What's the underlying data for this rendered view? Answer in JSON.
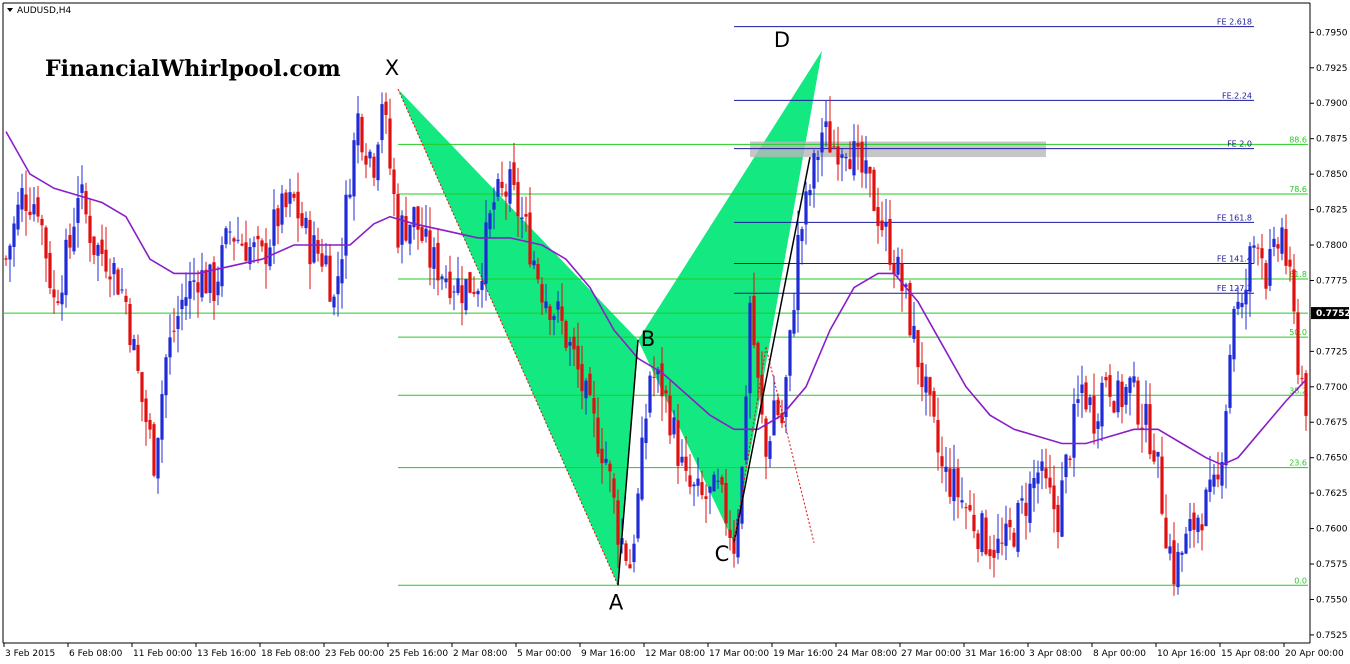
{
  "chart_data": {
    "type": "candlestick",
    "symbol": "AUDUSD,H4",
    "watermark": "FinancialWhirlpool.com",
    "colors": {
      "bull": "#1f2bd6",
      "bear": "#e01010",
      "moving_average": "#8a1ec8",
      "fib_line": "#22cc22",
      "fib_label": "#22cc22",
      "fe_line": "#1a1a9e",
      "fe_label": "#1a1a9e",
      "pattern_fill": "#00e676",
      "gray_zone": "#b8b8b8",
      "current_price_box": "#000000"
    },
    "ylim": [
      0.752,
      0.797
    ],
    "price_ticks": [
      "0.7950",
      "0.7925",
      "0.7900",
      "0.7875",
      "0.7850",
      "0.7825",
      "0.7800",
      "0.7775",
      "0.7725",
      "0.7700",
      "0.7675",
      "0.7650",
      "0.7625",
      "0.7600",
      "0.7575",
      "0.7550",
      "0.7525"
    ],
    "current_price": "0.7752",
    "x_ticks": [
      {
        "label": "3 Feb 2015",
        "bar": 0
      },
      {
        "label": "6 Feb 08:00",
        "bar": 16
      },
      {
        "label": "11 Feb 00:00",
        "bar": 32
      },
      {
        "label": "13 Feb 16:00",
        "bar": 48
      },
      {
        "label": "18 Feb 08:00",
        "bar": 64
      },
      {
        "label": "23 Feb 00:00",
        "bar": 80
      },
      {
        "label": "25 Feb 16:00",
        "bar": 96
      },
      {
        "label": "2 Mar 08:00",
        "bar": 112
      },
      {
        "label": "5 Mar 00:00",
        "bar": 128
      },
      {
        "label": "9 Mar 16:00",
        "bar": 144
      },
      {
        "label": "12 Mar 08:00",
        "bar": 160
      },
      {
        "label": "17 Mar 00:00",
        "bar": 176
      },
      {
        "label": "19 Mar 16:00",
        "bar": 192
      },
      {
        "label": "24 Mar 08:00",
        "bar": 208
      },
      {
        "label": "27 Mar 00:00",
        "bar": 224
      },
      {
        "label": "31 Mar 16:00",
        "bar": 240
      },
      {
        "label": "3 Apr 08:00",
        "bar": 256
      },
      {
        "label": "8 Apr 00:00",
        "bar": 272
      },
      {
        "label": "10 Apr 16:00",
        "bar": 288
      },
      {
        "label": "15 Apr 08:00",
        "bar": 304
      },
      {
        "label": "20 Apr 00:00",
        "bar": 320
      }
    ],
    "bar_count": 326,
    "close_path": [
      [
        0,
        0.779
      ],
      [
        4,
        0.7835
      ],
      [
        8,
        0.783
      ],
      [
        12,
        0.776
      ],
      [
        16,
        0.78
      ],
      [
        18,
        0.784
      ],
      [
        22,
        0.78
      ],
      [
        26,
        0.779
      ],
      [
        30,
        0.776
      ],
      [
        34,
        0.769
      ],
      [
        37,
        0.765
      ],
      [
        40,
        0.772
      ],
      [
        44,
        0.776
      ],
      [
        48,
        0.778
      ],
      [
        52,
        0.777
      ],
      [
        56,
        0.781
      ],
      [
        60,
        0.78
      ],
      [
        64,
        0.779
      ],
      [
        68,
        0.782
      ],
      [
        72,
        0.783
      ],
      [
        76,
        0.78
      ],
      [
        80,
        0.779
      ],
      [
        82,
        0.776
      ],
      [
        84,
        0.78
      ],
      [
        86,
        0.785
      ],
      [
        88,
        0.789
      ],
      [
        90,
        0.787
      ],
      [
        92,
        0.786
      ],
      [
        94,
        0.7905
      ],
      [
        96,
        0.7855
      ],
      [
        98,
        0.781
      ],
      [
        102,
        0.782
      ],
      [
        106,
        0.779
      ],
      [
        110,
        0.778
      ],
      [
        114,
        0.777
      ],
      [
        118,
        0.7775
      ],
      [
        122,
        0.783
      ],
      [
        126,
        0.784
      ],
      [
        130,
        0.781
      ],
      [
        134,
        0.777
      ],
      [
        138,
        0.775
      ],
      [
        142,
        0.772
      ],
      [
        146,
        0.768
      ],
      [
        150,
        0.765
      ],
      [
        153,
        0.76
      ],
      [
        156,
        0.7575
      ],
      [
        158,
        0.762
      ],
      [
        161,
        0.771
      ],
      [
        164,
        0.77
      ],
      [
        166,
        0.768
      ],
      [
        170,
        0.763
      ],
      [
        174,
        0.762
      ],
      [
        178,
        0.7625
      ],
      [
        180,
        0.761
      ],
      [
        182,
        0.759
      ],
      [
        184,
        0.764
      ],
      [
        186,
        0.776
      ],
      [
        188,
        0.77
      ],
      [
        190,
        0.765
      ],
      [
        192,
        0.769
      ],
      [
        194,
        0.7675
      ],
      [
        196,
        0.773
      ],
      [
        198,
        0.78
      ],
      [
        201,
        0.784
      ],
      [
        204,
        0.788
      ],
      [
        207,
        0.787
      ],
      [
        210,
        0.7875
      ],
      [
        213,
        0.7855
      ],
      [
        216,
        0.784
      ],
      [
        219,
        0.7815
      ],
      [
        222,
        0.779
      ],
      [
        225,
        0.776
      ],
      [
        228,
        0.772
      ],
      [
        231,
        0.768
      ],
      [
        234,
        0.764
      ],
      [
        237,
        0.763
      ],
      [
        240,
        0.7615
      ],
      [
        243,
        0.76
      ],
      [
        246,
        0.759
      ],
      [
        249,
        0.7585
      ],
      [
        252,
        0.76
      ],
      [
        255,
        0.762
      ],
      [
        258,
        0.764
      ],
      [
        261,
        0.762
      ],
      [
        263,
        0.761
      ],
      [
        266,
        0.766
      ],
      [
        269,
        0.77
      ],
      [
        272,
        0.768
      ],
      [
        275,
        0.771
      ],
      [
        278,
        0.769
      ],
      [
        281,
        0.77
      ],
      [
        284,
        0.768
      ],
      [
        287,
        0.766
      ],
      [
        290,
        0.76
      ],
      [
        292,
        0.757
      ],
      [
        295,
        0.759
      ],
      [
        298,
        0.761
      ],
      [
        301,
        0.762
      ],
      [
        303,
        0.763
      ],
      [
        305,
        0.769
      ],
      [
        307,
        0.776
      ],
      [
        309,
        0.775
      ],
      [
        311,
        0.779
      ],
      [
        313,
        0.781
      ],
      [
        315,
        0.778
      ],
      [
        317,
        0.779
      ],
      [
        319,
        0.781
      ],
      [
        321,
        0.777
      ],
      [
        323,
        0.772
      ],
      [
        325,
        0.769
      ]
    ],
    "moving_average": [
      [
        0,
        0.788
      ],
      [
        6,
        0.785
      ],
      [
        12,
        0.784
      ],
      [
        18,
        0.7835
      ],
      [
        24,
        0.783
      ],
      [
        30,
        0.782
      ],
      [
        36,
        0.779
      ],
      [
        42,
        0.778
      ],
      [
        48,
        0.778
      ],
      [
        56,
        0.7785
      ],
      [
        64,
        0.779
      ],
      [
        72,
        0.78
      ],
      [
        80,
        0.78
      ],
      [
        86,
        0.78
      ],
      [
        92,
        0.7815
      ],
      [
        96,
        0.782
      ],
      [
        102,
        0.7815
      ],
      [
        110,
        0.781
      ],
      [
        118,
        0.7805
      ],
      [
        126,
        0.7805
      ],
      [
        134,
        0.78
      ],
      [
        140,
        0.779
      ],
      [
        146,
        0.777
      ],
      [
        152,
        0.774
      ],
      [
        158,
        0.772
      ],
      [
        164,
        0.771
      ],
      [
        170,
        0.7695
      ],
      [
        176,
        0.768
      ],
      [
        182,
        0.767
      ],
      [
        188,
        0.767
      ],
      [
        194,
        0.768
      ],
      [
        200,
        0.77
      ],
      [
        206,
        0.774
      ],
      [
        212,
        0.777
      ],
      [
        218,
        0.778
      ],
      [
        222,
        0.778
      ],
      [
        228,
        0.776
      ],
      [
        234,
        0.773
      ],
      [
        240,
        0.77
      ],
      [
        246,
        0.768
      ],
      [
        252,
        0.767
      ],
      [
        258,
        0.7665
      ],
      [
        264,
        0.766
      ],
      [
        270,
        0.766
      ],
      [
        276,
        0.7665
      ],
      [
        282,
        0.767
      ],
      [
        288,
        0.767
      ],
      [
        294,
        0.766
      ],
      [
        300,
        0.765
      ],
      [
        304,
        0.7645
      ],
      [
        308,
        0.765
      ],
      [
        314,
        0.767
      ],
      [
        320,
        0.769
      ],
      [
        325,
        0.7705
      ]
    ],
    "pattern_points": [
      {
        "label": "X",
        "bar": 98,
        "price": 0.791
      },
      {
        "label": "A",
        "bar": 153,
        "price": 0.756
      },
      {
        "label": "B",
        "bar": 158,
        "price": 0.7733
      },
      {
        "label": "C",
        "bar": 182,
        "price": 0.759
      },
      {
        "label": "D",
        "bar": 204,
        "price": 0.7937
      }
    ],
    "fib_retracements": [
      {
        "label": "0.0",
        "price": 0.756
      },
      {
        "label": "23.6",
        "price": 0.7643
      },
      {
        "label": "38.2",
        "price": 0.7694
      },
      {
        "label": "50.0",
        "price": 0.7735
      },
      {
        "label": "61.8",
        "price": 0.7776
      },
      {
        "label": "78.6",
        "price": 0.7836
      },
      {
        "label": "88.6",
        "price": 0.7871
      }
    ],
    "fib_extensions": [
      {
        "label": "FE 127.2",
        "price": 0.7766
      },
      {
        "label": "FE 141.4",
        "price": 0.7787
      },
      {
        "label": "FE 161.8",
        "price": 0.7816
      },
      {
        "label": "FE 2.0",
        "price": 0.7868
      },
      {
        "label": "FE.2.24",
        "price": 0.7902
      },
      {
        "label": "FE 2.618",
        "price": 0.7954
      }
    ],
    "gray_zone": {
      "bar_start": 186,
      "bar_end": 260,
      "price_top": 0.7873,
      "price_bottom": 0.7862
    }
  }
}
